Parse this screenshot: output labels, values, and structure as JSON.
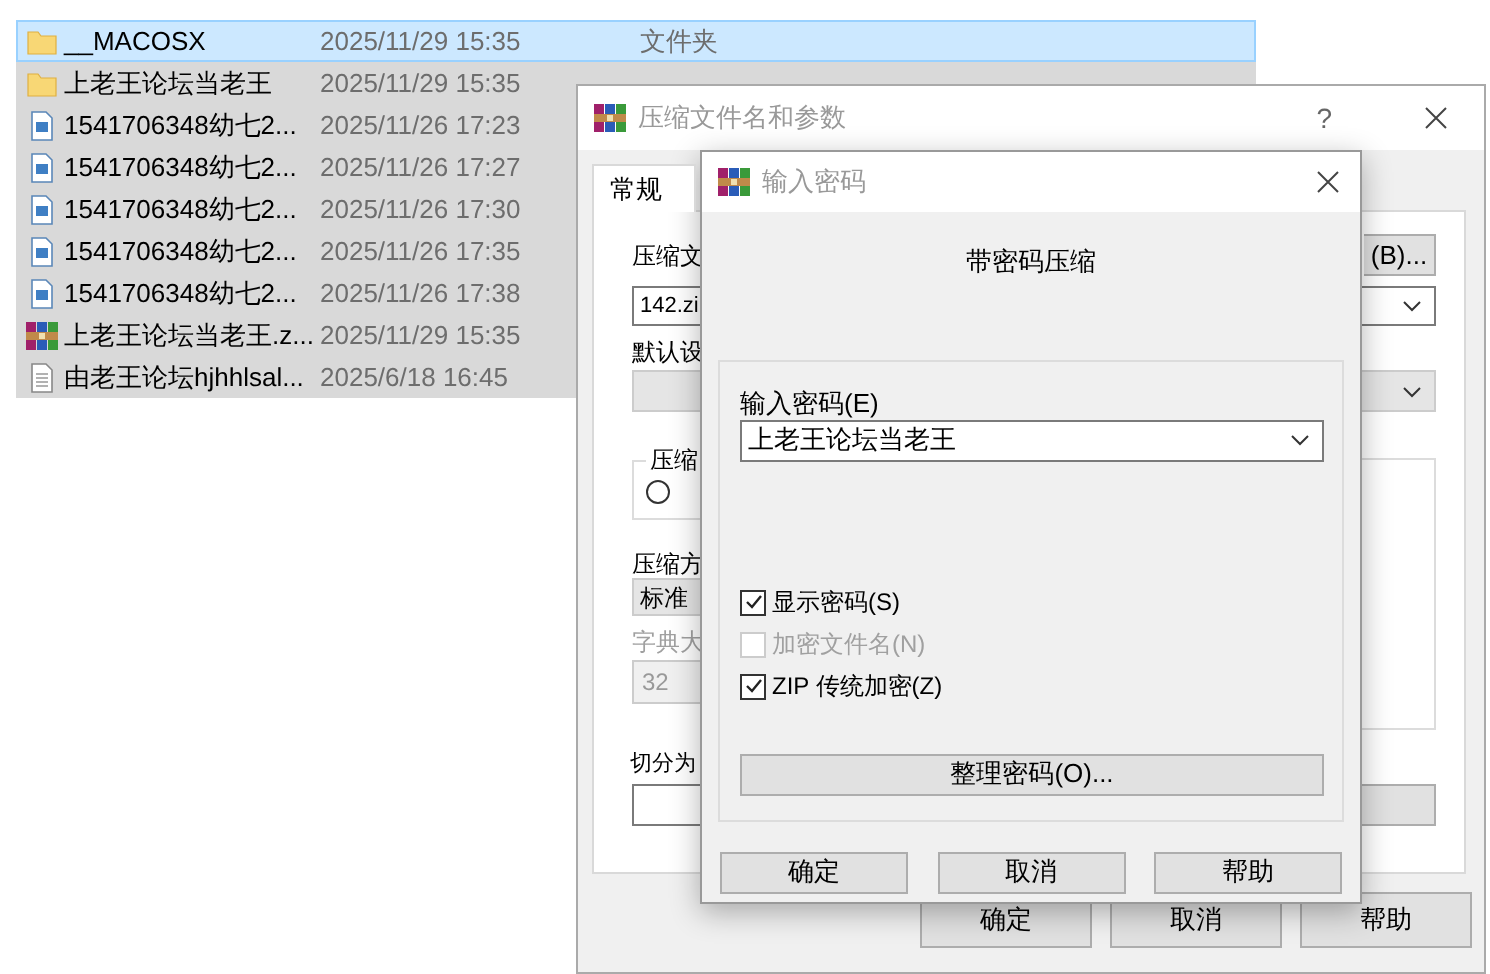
{
  "file_list": {
    "rows": [
      {
        "kind": "folder",
        "name": "__MACOSX",
        "date": "2025/11/29 15:35",
        "type": "文件夹",
        "selected": true,
        "focused": true
      },
      {
        "kind": "folder",
        "name": "上老王论坛当老王",
        "date": "2025/11/29 15:35",
        "selected": true,
        "focused": false
      },
      {
        "kind": "file",
        "name": "1541706348幼七2...",
        "date": "2025/11/26 17:23",
        "selected": true,
        "focused": false
      },
      {
        "kind": "file",
        "name": "1541706348幼七2...",
        "date": "2025/11/26 17:27",
        "selected": true,
        "focused": false
      },
      {
        "kind": "file",
        "name": "1541706348幼七2...",
        "date": "2025/11/26 17:30",
        "selected": true,
        "focused": false
      },
      {
        "kind": "file",
        "name": "1541706348幼七2...",
        "date": "2025/11/26 17:35",
        "selected": true,
        "focused": false
      },
      {
        "kind": "file",
        "name": "1541706348幼七2...",
        "date": "2025/11/26 17:38",
        "selected": true,
        "focused": false
      },
      {
        "kind": "archive",
        "name": "上老王论坛当老王.z...",
        "date": "2025/11/29 15:35",
        "selected": true,
        "focused": false
      },
      {
        "kind": "text",
        "name": "由老王论坛hjhhlsal...",
        "date": "2025/6/18 16:45",
        "selected": true,
        "focused": false
      }
    ]
  },
  "compress_dialog": {
    "title": "压缩文件名和参数",
    "help": "?",
    "tabs": [
      {
        "label": "常规",
        "selected": true
      }
    ],
    "archive_name_label": "压缩文",
    "browse_button": "(B)...",
    "archive_name": "142.zi",
    "profile_label": "默认设",
    "format_group_label": "压缩",
    "format_option": {
      "selected": false
    },
    "method": {
      "label": "压缩方",
      "value": "标准",
      "disabled": false
    },
    "dictionary": {
      "label": "字典大",
      "value": "32",
      "disabled": true
    },
    "split_label": "切分为",
    "buttons": [
      "确定",
      "取消",
      "帮助"
    ]
  },
  "password_dialog": {
    "title": "输入密码",
    "heading": "带密码压缩",
    "password_label": "输入密码(E)",
    "password": "上老王论坛当老王",
    "options": [
      {
        "label": "显示密码(S)",
        "checked": true,
        "disabled": false
      },
      {
        "label": "加密文件名(N)",
        "checked": false,
        "disabled": true
      },
      {
        "label": "ZIP 传统加密(Z)",
        "checked": true,
        "disabled": false
      }
    ],
    "organize_button": "整理密码(O)...",
    "buttons": [
      "确定",
      "取消",
      "帮助"
    ]
  }
}
